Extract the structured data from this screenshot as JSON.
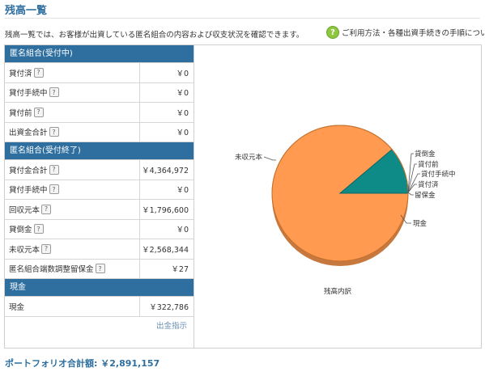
{
  "page": {
    "title": "残高一覧",
    "description": "残高一覧では、お客様が出資している匿名組合の内容および収支状況を確認できます。",
    "help_icon": "?",
    "help_link": "ご利用方法・各種出資手続きの手順について"
  },
  "colors": {
    "header_blue": "#2f6f9f",
    "pie_orange": "#ff9a50",
    "pie_teal": "#0e8a87",
    "help_green": "#8dc63f"
  },
  "sections": [
    {
      "header": "匿名組合(受付中)",
      "rows": [
        {
          "label": "貸付済",
          "value": "￥0"
        },
        {
          "label": "貸付手続中",
          "value": "￥0"
        },
        {
          "label": "貸付前",
          "value": "￥0"
        },
        {
          "label": "出資金合計",
          "value": "￥0"
        }
      ]
    },
    {
      "header": "匿名組合(受付終了)",
      "rows": [
        {
          "label": "貸付金合計",
          "value": "￥4,364,972"
        },
        {
          "label": "貸付手続中",
          "value": "￥0"
        },
        {
          "label": "回収元本",
          "value": "￥1,796,600"
        },
        {
          "label": "貸倒金",
          "value": "￥0"
        },
        {
          "label": "未収元本",
          "value": "￥2,568,344"
        },
        {
          "label": "匿名組合端数調整留保金",
          "value": "￥27"
        }
      ]
    },
    {
      "header": "現金",
      "rows": [
        {
          "label": "現金",
          "value": "￥322,786"
        }
      ]
    }
  ],
  "action_link": "出金指示",
  "question_icon": "?",
  "chart_data": {
    "type": "pie",
    "title": "残高内訳",
    "slices": [
      {
        "label": "未収元本",
        "value": 2568344,
        "color": "#ff9a50"
      },
      {
        "label": "現金",
        "value": 322786,
        "color": "#0e8a87"
      },
      {
        "label": "留保金",
        "value": 27,
        "color": "#0e8a87"
      },
      {
        "label": "貸付済",
        "value": 0,
        "color": "#0e8a87"
      },
      {
        "label": "貸付手続中",
        "value": 0,
        "color": "#0e8a87"
      },
      {
        "label": "貸付前",
        "value": 0,
        "color": "#0e8a87"
      },
      {
        "label": "貸倒金",
        "value": 0,
        "color": "#0e8a87"
      }
    ]
  },
  "total": {
    "label": "ポートフォリオ合計額:",
    "value": "￥2,891,157"
  }
}
